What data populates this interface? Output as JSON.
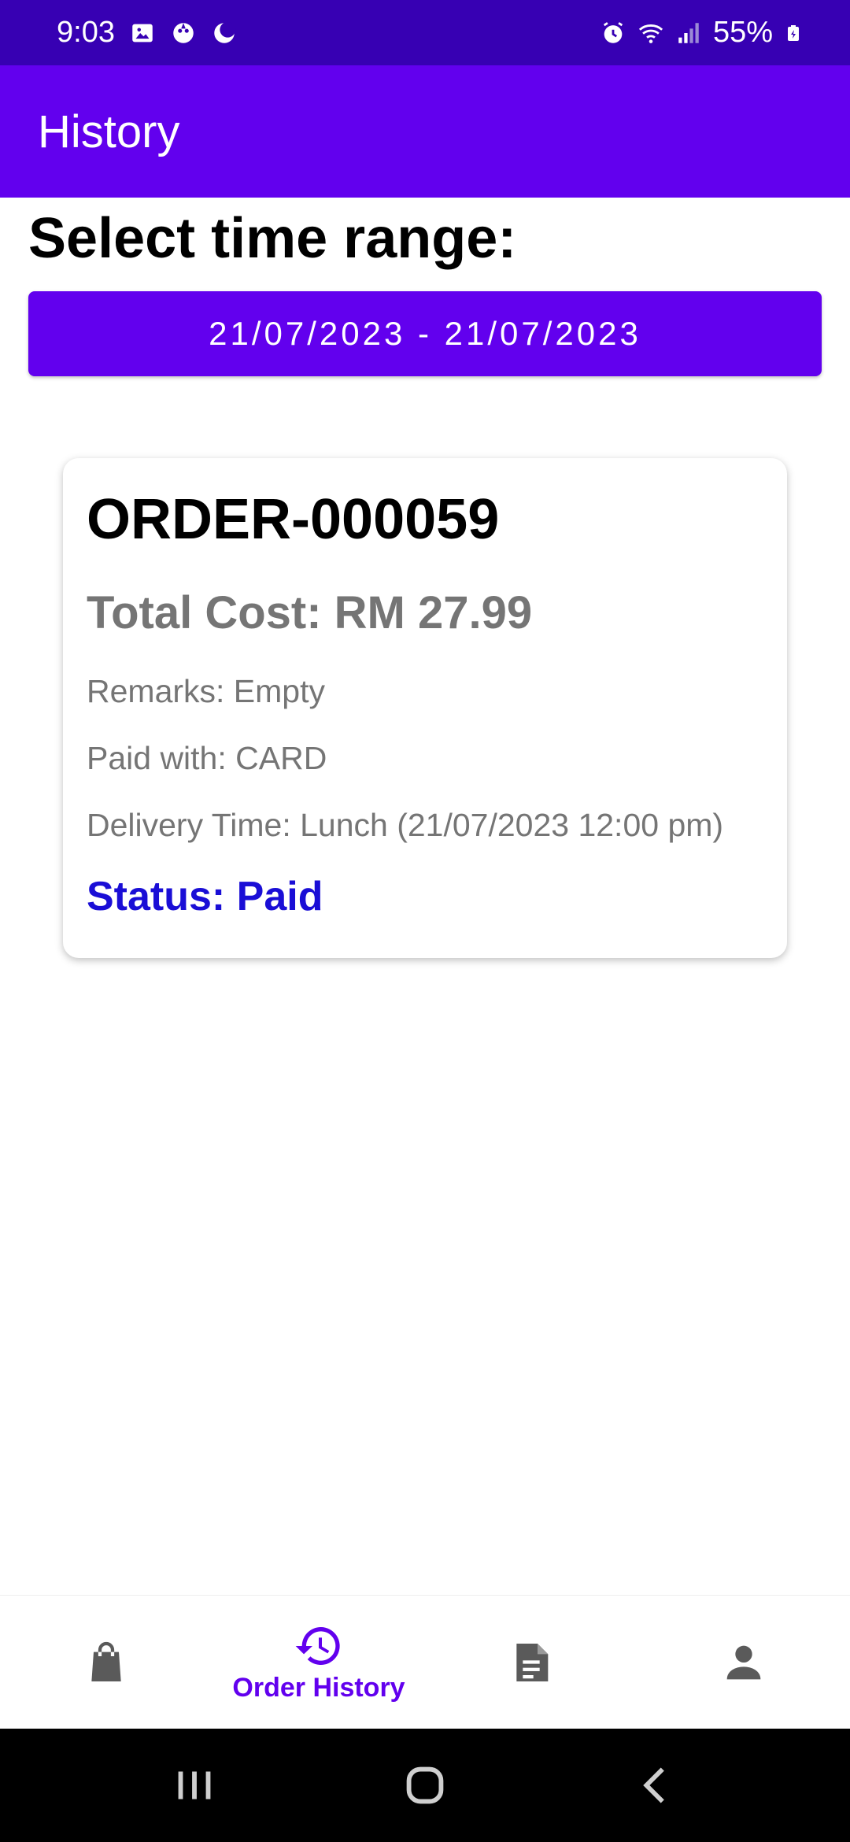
{
  "status_bar": {
    "time": "9:03",
    "battery": "55%",
    "icons_left": [
      "image-icon",
      "game-icon",
      "moon-icon"
    ],
    "icons_right": [
      "alarm-icon",
      "wifi-icon",
      "signal-icon",
      "battery-icon"
    ]
  },
  "app_bar": {
    "title": "History"
  },
  "range": {
    "title": "Select time range:",
    "button_label": "21/07/2023 - 21/07/2023"
  },
  "orders": [
    {
      "id": "ORDER-000059",
      "total_cost": "Total Cost: RM 27.99",
      "remarks": "Remarks: Empty",
      "paid_with": "Paid with: CARD",
      "delivery_time": "Delivery Time: Lunch (21/07/2023 12:00 pm)",
      "status": "Status: Paid"
    }
  ],
  "bottom_nav": {
    "items": [
      {
        "icon": "shopping-bag-icon",
        "label": ""
      },
      {
        "icon": "history-icon",
        "label": "Order History",
        "active": true
      },
      {
        "icon": "document-icon",
        "label": ""
      },
      {
        "icon": "person-icon",
        "label": ""
      }
    ]
  },
  "colors": {
    "status_bar": "#3700b3",
    "primary": "#6200ee",
    "status_text": "#1a0ed6",
    "secondary_text": "#757575"
  }
}
